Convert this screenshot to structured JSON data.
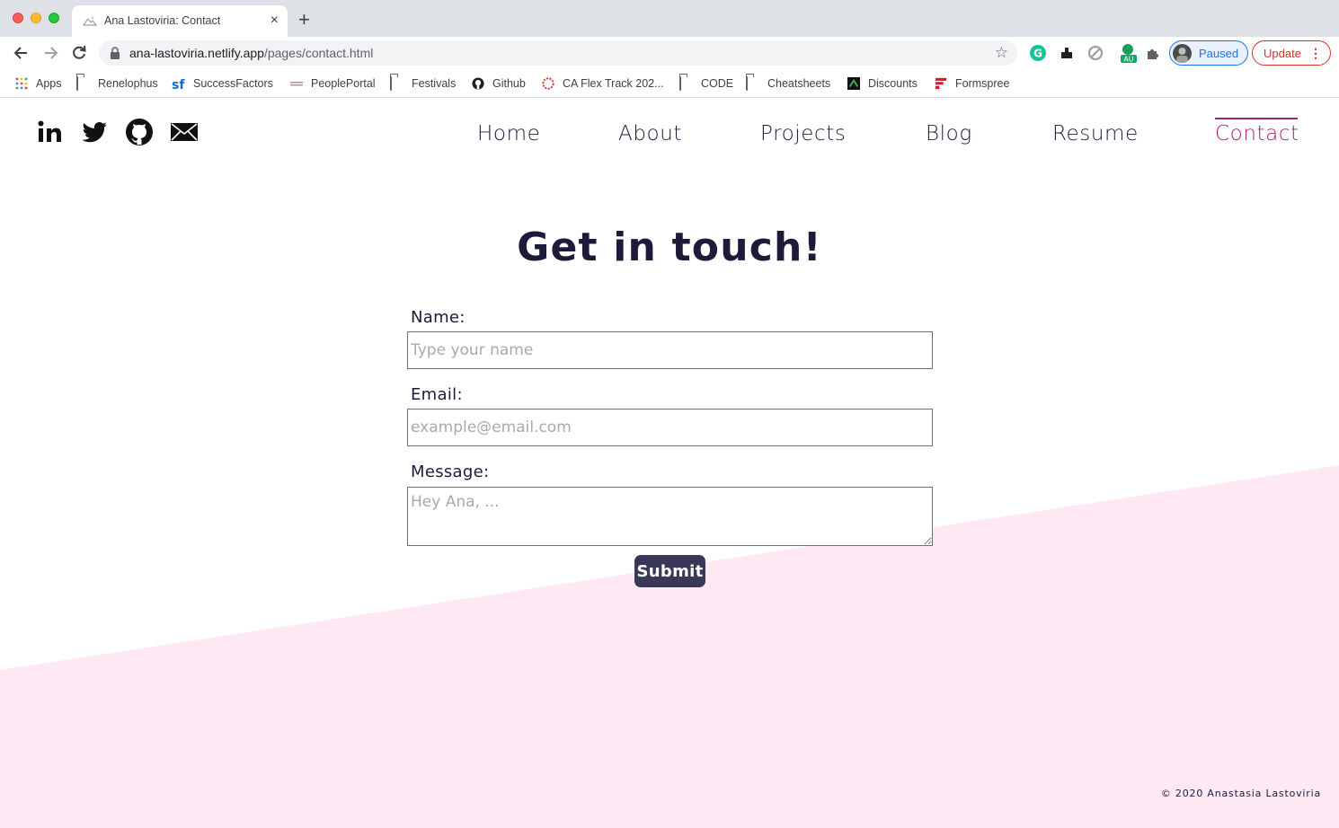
{
  "browser": {
    "tab_title": "Ana Lastoviria: Contact",
    "tab_close": "×",
    "new_tab": "+",
    "url_host": "ana-lastoviria.netlify.app",
    "url_path": "/pages/contact.html",
    "star": "☆",
    "profile_label": "Paused",
    "update_label": "Update",
    "update_menu": "⋮",
    "bookmarks": [
      {
        "label": "Apps",
        "icon": "apps-grid-icon"
      },
      {
        "label": "Renelophus",
        "icon": "folder-icon"
      },
      {
        "label": "SuccessFactors",
        "icon": "successfactors-icon"
      },
      {
        "label": "PeoplePortal",
        "icon": "peopleportal-icon"
      },
      {
        "label": "Festivals",
        "icon": "folder-icon"
      },
      {
        "label": "Github",
        "icon": "github-icon"
      },
      {
        "label": "CA Flex Track 202...",
        "icon": "ca-icon"
      },
      {
        "label": "CODE",
        "icon": "folder-icon"
      },
      {
        "label": "Cheatsheets",
        "icon": "folder-icon"
      },
      {
        "label": "Discounts",
        "icon": "discounts-icon"
      },
      {
        "label": "Formspree",
        "icon": "formspree-icon"
      }
    ]
  },
  "site": {
    "social": [
      "linkedin-icon",
      "twitter-icon",
      "github-icon",
      "email-icon"
    ],
    "nav": [
      {
        "label": "Home"
      },
      {
        "label": "About"
      },
      {
        "label": "Projects"
      },
      {
        "label": "Blog"
      },
      {
        "label": "Resume"
      },
      {
        "label": "Contact",
        "active": true
      }
    ],
    "heading": "Get in touch!",
    "form": {
      "name_label": "Name:",
      "name_placeholder": "Type your name",
      "email_label": "Email:",
      "email_placeholder": "example@email.com",
      "message_label": "Message:",
      "message_placeholder": "Hey Ana, ...",
      "submit_label": "Submit"
    },
    "footer": "© 2020 Anastasia Lastoviria"
  },
  "colors": {
    "accent": "#a0246f",
    "text": "#1c1c3a",
    "button": "#3a3858",
    "pink_band": "#fde8f4"
  }
}
